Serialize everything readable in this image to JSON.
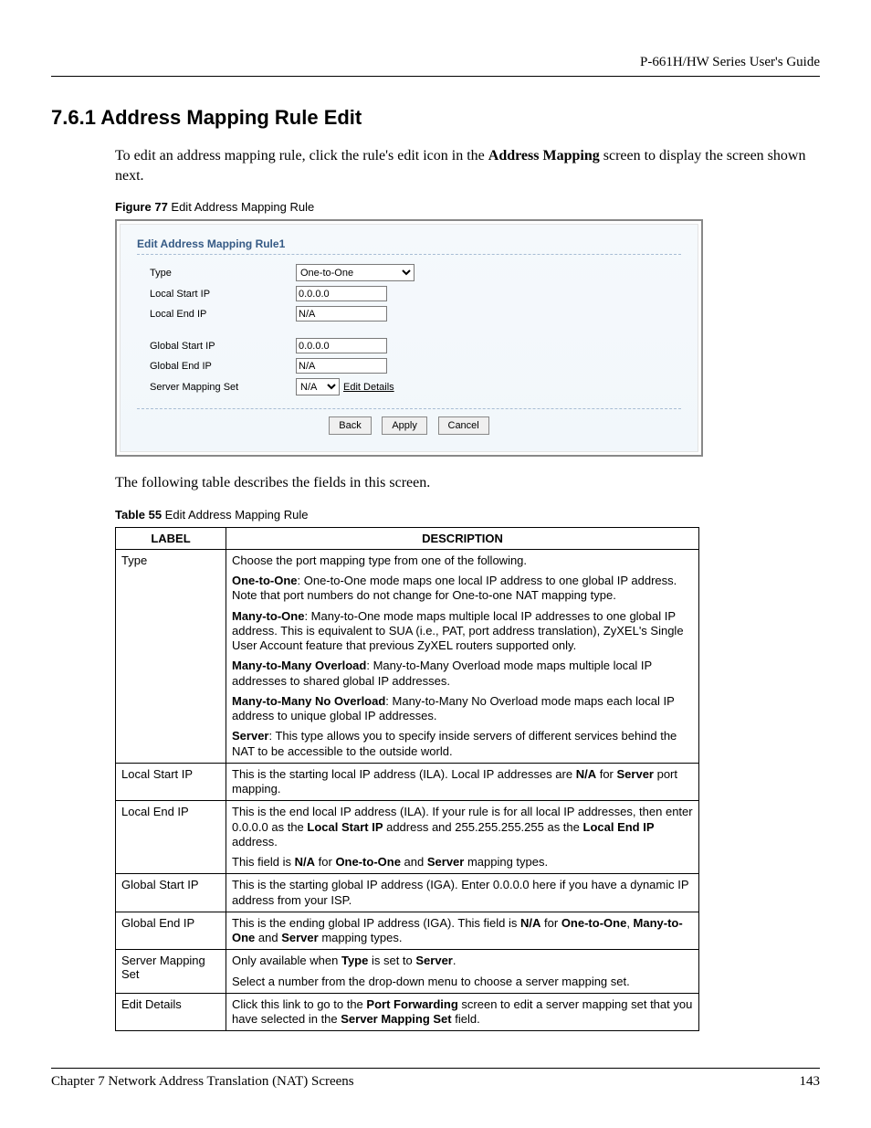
{
  "header": {
    "guide_title": "P-661H/HW Series User's Guide"
  },
  "section": {
    "number_title": "7.6.1  Address Mapping Rule Edit",
    "intro_a": "To edit an address mapping rule, click the rule's edit icon in the ",
    "intro_bold": "Address Mapping",
    "intro_b": " screen to display the screen shown next."
  },
  "figure": {
    "caption_strong": "Figure 77",
    "caption_rest": "   Edit Address Mapping Rule",
    "panel_title": "Edit Address Mapping Rule1",
    "labels": {
      "type": "Type",
      "local_start_ip": "Local Start IP",
      "local_end_ip": "Local End IP",
      "global_start_ip": "Global Start IP",
      "global_end_ip": "Global End IP",
      "server_mapping_set": "Server Mapping Set"
    },
    "values": {
      "type_selected": "One-to-One",
      "local_start_ip": "0.0.0.0",
      "local_end_ip": "N/A",
      "global_start_ip": "0.0.0.0",
      "global_end_ip": "N/A",
      "server_mapping_set_selected": "N/A"
    },
    "edit_details_link": "Edit Details",
    "buttons": {
      "back": "Back",
      "apply": "Apply",
      "cancel": "Cancel"
    }
  },
  "after_figure_text": "The following table describes the fields in this screen.",
  "table_caption": {
    "strong": "Table 55",
    "rest": "   Edit Address Mapping Rule"
  },
  "table_headers": {
    "label": "LABEL",
    "description": "DESCRIPTION"
  },
  "rows": {
    "type": {
      "label": "Type",
      "p1": "Choose the port mapping type from one of the following.",
      "p2a": "One-to-One",
      "p2b": ": One-to-One mode maps one local IP address to one global IP address. Note that port numbers do not change for One-to-one NAT mapping type.",
      "p3a": "Many-to-One",
      "p3b": ": Many-to-One mode maps multiple local IP addresses to one global IP address. This is equivalent to SUA (i.e., PAT, port address translation), ZyXEL's Single User Account feature that previous ZyXEL routers supported only.",
      "p4a": "Many-to-Many Overload",
      "p4b": ": Many-to-Many Overload mode maps multiple local IP addresses to shared global IP addresses.",
      "p5a": "Many-to-Many No Overload",
      "p5b": ": Many-to-Many No Overload mode maps each local IP address to unique global IP addresses.",
      "p6a": "Server",
      "p6b": ": This type allows you to specify inside servers of different services behind the NAT to be accessible to the outside world."
    },
    "local_start_ip": {
      "label": "Local Start IP",
      "t1": "This is the starting local IP address (ILA). Local IP addresses are ",
      "b1": "N/A",
      "t2": " for ",
      "b2": "Server",
      "t3": " port mapping."
    },
    "local_end_ip": {
      "label": "Local End IP",
      "p1a": "This is the end local IP address (ILA). If your rule is for all local IP addresses, then enter 0.0.0.0 as the ",
      "p1b": "Local Start IP",
      "p1c": " address and 255.255.255.255 as the ",
      "p1d": "Local End IP",
      "p1e": " address.",
      "p2a": "This field is ",
      "p2b": "N/A",
      "p2c": " for ",
      "p2d": "One-to-One",
      "p2e": " and ",
      "p2f": "Server",
      "p2g": " mapping types."
    },
    "global_start_ip": {
      "label": "Global Start IP",
      "t": "This is the starting global IP address (IGA). Enter 0.0.0.0 here if you have a dynamic IP address from your ISP."
    },
    "global_end_ip": {
      "label": "Global End IP",
      "t1": "This is the ending global IP address (IGA). This field is ",
      "b1": "N/A",
      "t2": " for ",
      "b2": "One-to-One",
      "t3": ", ",
      "b3": "Many-to-One",
      "t4": " and ",
      "b4": "Server",
      "t5": " mapping types."
    },
    "server_mapping_set": {
      "label": "Server Mapping Set",
      "p1a": "Only available when ",
      "p1b": "Type",
      "p1c": " is set to ",
      "p1d": "Server",
      "p1e": ".",
      "p2": "Select a number from the drop-down menu to choose a server mapping set."
    },
    "edit_details": {
      "label": "Edit Details",
      "t1": "Click this link to go to the ",
      "b1": "Port Forwarding",
      "t2": " screen to edit a server mapping set that you have selected in the ",
      "b2": "Server Mapping Set",
      "t3": " field."
    }
  },
  "footer": {
    "chapter": "Chapter 7 Network Address Translation (NAT) Screens",
    "page": "143"
  }
}
